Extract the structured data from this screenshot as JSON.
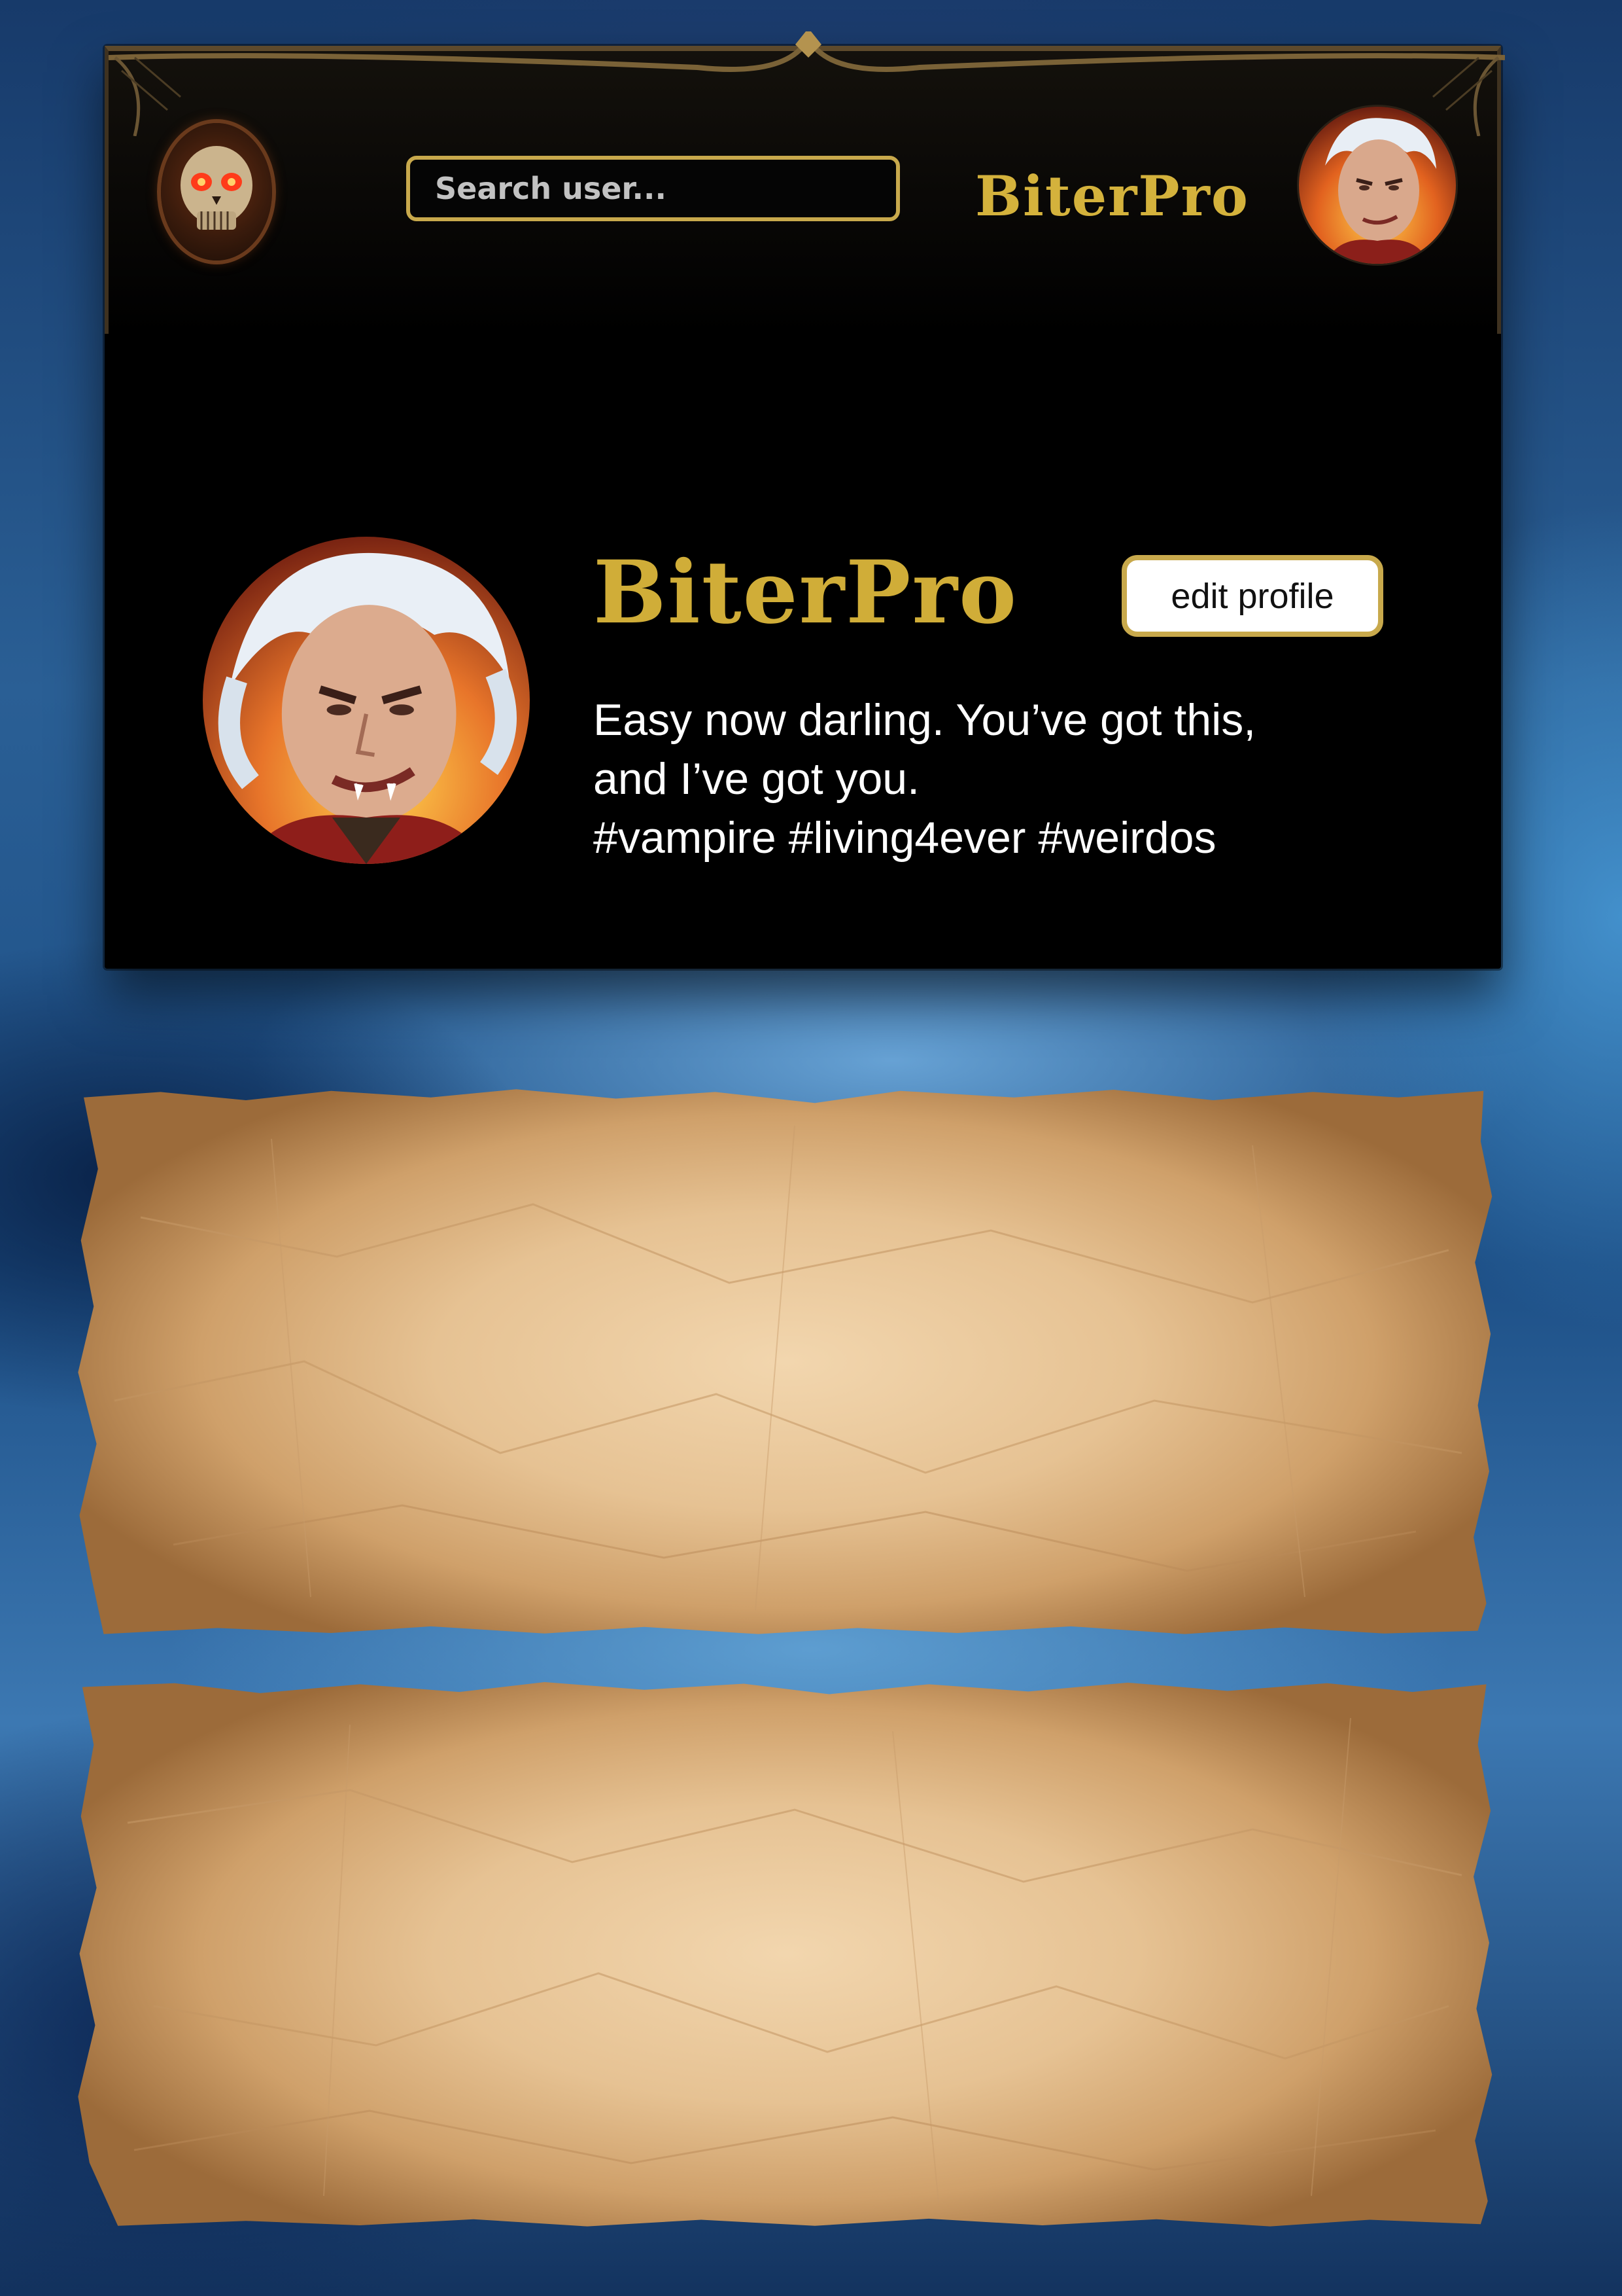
{
  "header": {
    "logo_icon": "skull-icon",
    "search_placeholder": "Search user...",
    "brand_name": "BiterPro",
    "user_avatar_icon": "user-avatar"
  },
  "profile": {
    "name": "BiterPro",
    "edit_label": "edit profile",
    "bio_lines": [
      "Easy now darling. You’ve got this,",
      "and I’ve got you.",
      "#vampire #living4ever #weirdos"
    ]
  },
  "posts": [
    {
      "style": "parchment"
    },
    {
      "style": "parchment"
    }
  ],
  "colors": {
    "accent_gold": "#c8a94c",
    "brand_gold": "#d4b23c",
    "panel_bg": "#000000",
    "parchment": "#e6c293"
  }
}
